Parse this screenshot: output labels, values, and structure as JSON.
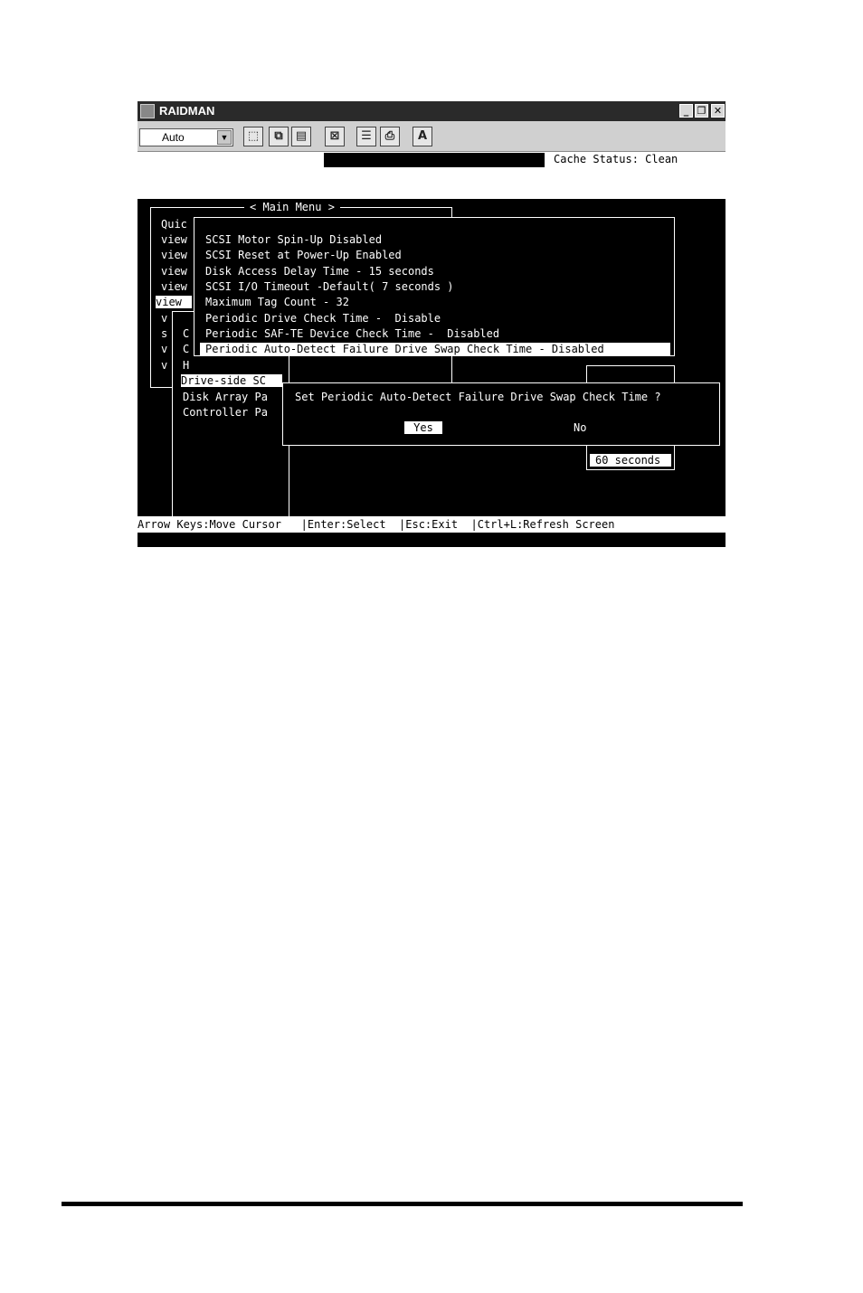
{
  "window": {
    "title": "RAIDMAN",
    "buttons": {
      "minimize": "_",
      "restore": "❐",
      "close": "✕"
    }
  },
  "toolbar": {
    "mode_select": "Auto",
    "tool_text_button": "A"
  },
  "status": {
    "cache_status": "Cache Status: Clean"
  },
  "main_menu": {
    "title": "< Main Menu >",
    "items": [
      "Quic",
      "view",
      "view",
      "view",
      "view",
      "view",
      "v",
      "s",
      "v",
      "v"
    ]
  },
  "submenu": {
    "labels": [
      "C",
      "C",
      "H"
    ],
    "drive_side": "Drive-side SC",
    "disk_array": "Disk Array Pa",
    "controller": "Controller Pa"
  },
  "drive_params": {
    "items": [
      "SCSI Motor Spin-Up Disabled",
      "SCSI Reset at Power-Up Enabled",
      "Disk Access Delay Time - 15 seconds",
      "SCSI I/O Timeout -Default( 7 seconds )",
      "Maximum Tag Count - 32",
      "Periodic Drive Check Time -  Disable",
      "Periodic SAF-TE Device Check Time -  Disabled",
      "Periodic Auto-Detect Failure Drive Swap Check Time - Disabled"
    ]
  },
  "confirm": {
    "question": "Set Periodic Auto-Detect Failure Drive Swap Check Time ?",
    "yes": "Yes",
    "no": "No"
  },
  "time_option": "60 seconds",
  "footer": {
    "move": "Arrow Keys:Move Cursor",
    "select": "|Enter:Select",
    "exit": "|Esc:Exit",
    "refresh": "|Ctrl+L:Refresh Screen"
  }
}
